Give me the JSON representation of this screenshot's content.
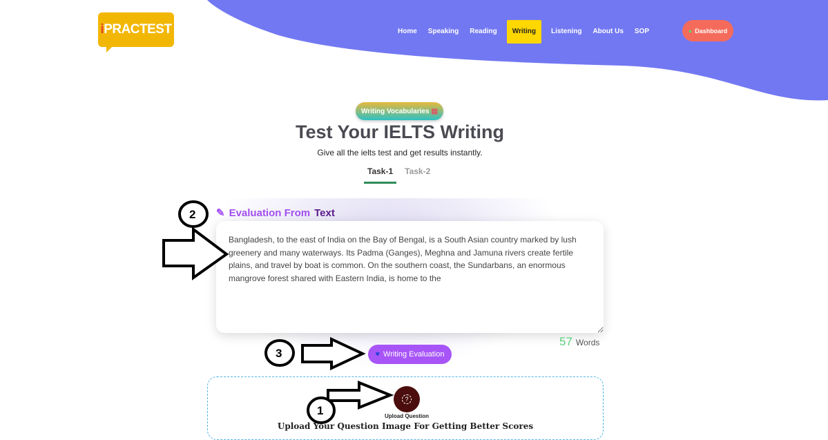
{
  "header": {
    "logo": "iPRACTEST",
    "nav": [
      "Home",
      "Speaking",
      "Reading",
      "Writing",
      "Listening",
      "About Us",
      "SOP"
    ],
    "active": "Writing",
    "dashboard": "Dashboard",
    "accent": "#7278f2"
  },
  "hero": {
    "vocab_button": "Writing Vocabularies",
    "title": "Test Your IELTS Writing",
    "subtitle": "Give all the ielts test and get results instantly.",
    "tabs": [
      "Task-1",
      "Task-2"
    ],
    "active_tab": "Task-1"
  },
  "evaluation": {
    "heading_a": "Evaluation From",
    "heading_b": "Text",
    "text": "Bangladesh, to the east of India on the Bay of Bengal, is a South Asian country marked by lush greenery and many waterways. Its Padma (Ganges), Meghna and Jamuna rivers create fertile plains, and travel by boat is common. On the southern coast, the Sundarbans, an enormous mangrove forest shared with Eastern India, is home to the",
    "word_count": "57",
    "word_label": "Words",
    "button": "Writing Evaluation"
  },
  "upload": {
    "button_label": "Upload Question",
    "caption": "Upload Your Question Image For Getting Better Scores"
  },
  "annotations": [
    "1",
    "2",
    "3"
  ]
}
